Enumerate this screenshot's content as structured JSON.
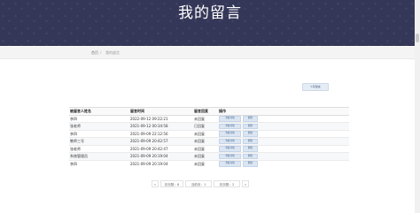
{
  "header": {
    "title": "我的留言"
  },
  "breadcrumb": {
    "home": "首页",
    "separator": "/",
    "current": "我的留言"
  },
  "toolbar": {
    "write_label": "写留言"
  },
  "table": {
    "columns": [
      "被留言人姓名",
      "留言时间",
      "留言回复",
      "操作"
    ],
    "rows": [
      {
        "name": "李四",
        "time": "2022-09-12 09:22:21",
        "status": "未回复"
      },
      {
        "name": "张老师",
        "time": "2021-09-12 00:34:58",
        "status": "已回复"
      },
      {
        "name": "李四",
        "time": "2021-09-09 22:12:56",
        "status": "未回复"
      },
      {
        "name": "教师三号",
        "time": "2021-09-09 20:42:57",
        "status": "未回复"
      },
      {
        "name": "张老师",
        "time": "2021-09-09 20:42:47",
        "status": "未回复"
      },
      {
        "name": "系统管理员",
        "time": "2021-09-09 20:19:04",
        "status": "未回复"
      },
      {
        "name": "李四",
        "time": "2021-09-09 20:19:04",
        "status": "未回复"
      }
    ],
    "actions": {
      "view": "查看详情",
      "delete": "删除"
    }
  },
  "pagination": {
    "prev": "«",
    "total_records": "总页数：8",
    "current_page": "当前页：1",
    "total_pages": "总页数：2",
    "next": "»"
  },
  "colors": {
    "banner": "#353758",
    "button_bg": "#dbe6f2"
  }
}
